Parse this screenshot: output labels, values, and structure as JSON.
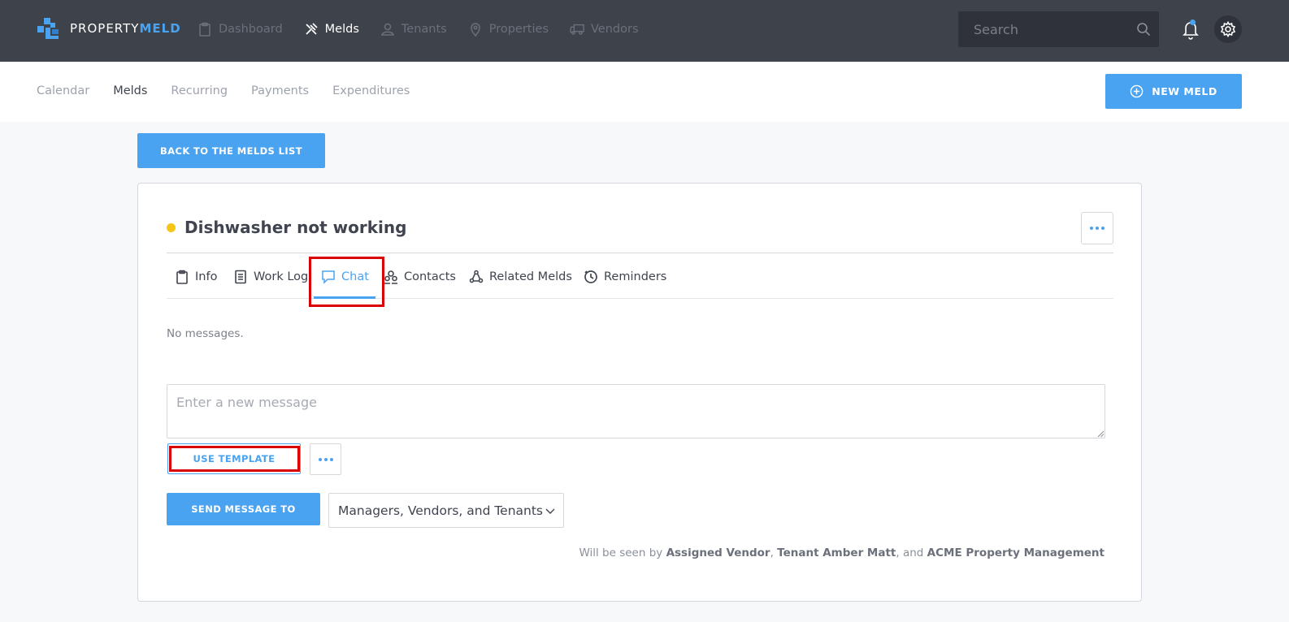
{
  "app": {
    "logo_prefix": "PROPERTY",
    "logo_suffix": "MELD",
    "brand_color": "#4aa3f0"
  },
  "topnav": {
    "items": [
      {
        "label": "Dashboard",
        "icon": "clipboard-icon",
        "active": false
      },
      {
        "label": "Melds",
        "icon": "tools-icon",
        "active": true
      },
      {
        "label": "Tenants",
        "icon": "user-icon",
        "active": false
      },
      {
        "label": "Properties",
        "icon": "map-pin-icon",
        "active": false
      },
      {
        "label": "Vendors",
        "icon": "truck-icon",
        "active": false
      }
    ],
    "search_placeholder": "Search"
  },
  "subnav": {
    "items": [
      {
        "label": "Calendar",
        "active": false
      },
      {
        "label": "Melds",
        "active": true
      },
      {
        "label": "Recurring",
        "active": false
      },
      {
        "label": "Payments",
        "active": false
      },
      {
        "label": "Expenditures",
        "active": false
      }
    ],
    "new_meld_label": "NEW MELD"
  },
  "back_label": "BACK TO THE MELDS LIST",
  "meld": {
    "title": "Dishwasher not working",
    "status_color": "#f5c518"
  },
  "tabs": [
    {
      "label": "Info",
      "icon": "clipboard-icon"
    },
    {
      "label": "Work Log",
      "icon": "document-icon"
    },
    {
      "label": "Chat",
      "icon": "chat-bubble-icon",
      "active": true
    },
    {
      "label": "Contacts",
      "icon": "contacts-icon"
    },
    {
      "label": "Related Melds",
      "icon": "related-icon"
    },
    {
      "label": "Reminders",
      "icon": "clock-icon"
    }
  ],
  "chat": {
    "empty_text": "No messages.",
    "input_placeholder": "Enter a new message",
    "template_label": "USE TEMPLATE",
    "send_label": "SEND MESSAGE TO",
    "recipients_selected": "Managers, Vendors, and Tenants",
    "seen_prefix": "Will be seen by ",
    "seen_vendor": "Assigned Vendor",
    "seen_sep1": ", ",
    "seen_tenant": "Tenant Amber Matt",
    "seen_sep2": ", and ",
    "seen_company": "ACME Property Management"
  },
  "highlight_color": "#d80000"
}
